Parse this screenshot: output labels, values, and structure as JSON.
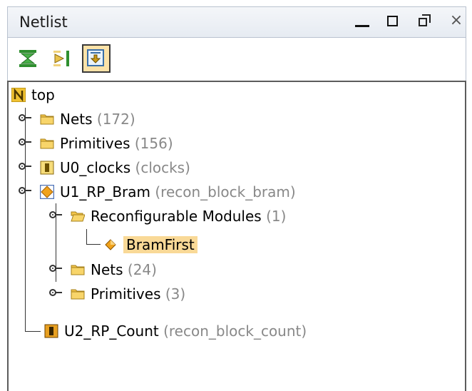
{
  "window": {
    "title": "Netlist",
    "minimize_label": "minimize",
    "maximize_label": "maximize",
    "restore_label": "restore",
    "close_glyph": "×"
  },
  "toolbar": {
    "buttons": [
      {
        "icon": "collapse-all-icon",
        "pressed": false
      },
      {
        "icon": "expand-all-icon",
        "pressed": false
      },
      {
        "icon": "auto-scroll-icon",
        "pressed": true
      }
    ]
  },
  "tree": {
    "root": {
      "label": "top",
      "icon": "netlist-n-icon"
    },
    "nodes": [
      {
        "name": "Nets",
        "detail": "(172)",
        "icon": "folder-icon"
      },
      {
        "name": "Primitives",
        "detail": "(156)",
        "icon": "folder-icon"
      },
      {
        "name": "U0_clocks",
        "detail": "(clocks)",
        "icon": "module-icon"
      },
      {
        "name": "U1_RP_Bram",
        "detail": "(recon_block_bram)",
        "icon": "reconfig-partition-icon"
      },
      {
        "name": "Reconfigurable Modules",
        "detail": "(1)",
        "icon": "folder-open-icon"
      },
      {
        "name": "BramFirst",
        "detail": "",
        "icon": "reconfig-module-icon",
        "selected": true
      },
      {
        "name": "Nets",
        "detail": "(24)",
        "icon": "folder-icon"
      },
      {
        "name": "Primitives",
        "detail": "(3)",
        "icon": "folder-icon"
      },
      {
        "name": "U2_RP_Count",
        "detail": "(recon_block_count)",
        "icon": "module-icon"
      }
    ]
  },
  "colors": {
    "selection": "#f9d997",
    "paren_text": "#888888",
    "folder": "#f3c54a"
  }
}
